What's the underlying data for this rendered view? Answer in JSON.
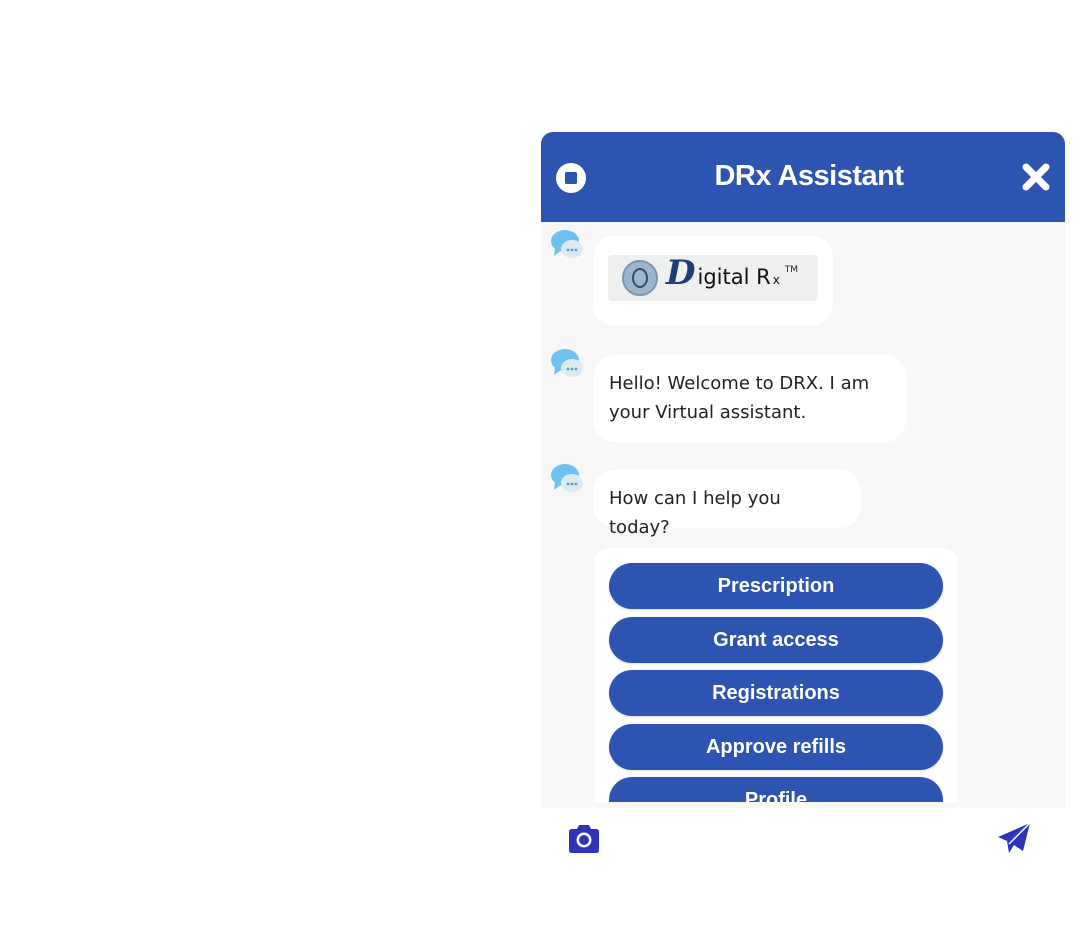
{
  "header": {
    "title": "DRx Assistant",
    "stop_icon": "stop-circle-icon",
    "close_icon": "close-x-icon"
  },
  "messages": [
    {
      "type": "logo",
      "logo_text_d": "D",
      "logo_text_rest": "igital R",
      "logo_sub": "x",
      "logo_tm": "TM"
    },
    {
      "type": "text",
      "text": "Hello! Welcome to DRX. I am your Virtual assistant."
    },
    {
      "type": "text",
      "text": "How can I help you today?"
    }
  ],
  "options": [
    {
      "label": "Prescription"
    },
    {
      "label": "Grant access"
    },
    {
      "label": "Registrations"
    },
    {
      "label": "Approve refills"
    },
    {
      "label": "Profile"
    }
  ],
  "footer": {
    "camera_icon": "camera-icon",
    "send_icon": "send-paper-plane-icon"
  },
  "colors": {
    "brand": "#2d54b0",
    "background": "#f7f7f7",
    "bubble": "#ffffff",
    "footer_icons": "#2e33b8"
  }
}
